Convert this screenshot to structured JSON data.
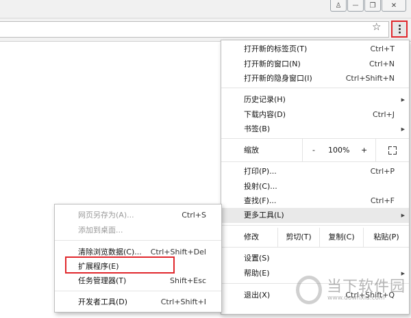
{
  "window_controls": {
    "user": "♙",
    "minimize": "—",
    "restore": "❐",
    "close": "✕"
  },
  "toolbar": {
    "star": "☆"
  },
  "main_menu": {
    "new_tab": {
      "label": "打开新的标签页(T)",
      "shortcut": "Ctrl+T"
    },
    "new_window": {
      "label": "打开新的窗口(N)",
      "shortcut": "Ctrl+N"
    },
    "new_incognito": {
      "label": "打开新的隐身窗口(I)",
      "shortcut": "Ctrl+Shift+N"
    },
    "history": {
      "label": "历史记录(H)"
    },
    "downloads": {
      "label": "下载内容(D)",
      "shortcut": "Ctrl+J"
    },
    "bookmarks": {
      "label": "书签(B)"
    },
    "zoom": {
      "label": "缩放",
      "minus": "-",
      "value": "100%",
      "plus": "+"
    },
    "print": {
      "label": "打印(P)...",
      "shortcut": "Ctrl+P"
    },
    "cast": {
      "label": "投射(C)..."
    },
    "find": {
      "label": "查找(F)...",
      "shortcut": "Ctrl+F"
    },
    "more_tools": {
      "label": "更多工具(L)"
    },
    "edit": {
      "label": "修改",
      "cut": "剪切(T)",
      "copy": "复制(C)",
      "paste": "粘贴(P)"
    },
    "settings": {
      "label": "设置(S)"
    },
    "help": {
      "label": "帮助(E)"
    },
    "exit": {
      "label": "退出(X)",
      "shortcut": "Ctrl+Shift+Q"
    }
  },
  "sub_menu": {
    "save_page": {
      "label": "网页另存为(A)...",
      "shortcut": "Ctrl+S"
    },
    "add_desktop": {
      "label": "添加到桌面..."
    },
    "clear_data": {
      "label": "清除浏览数据(C)...",
      "shortcut": "Ctrl+Shift+Del"
    },
    "extensions": {
      "label": "扩展程序(E)"
    },
    "task_manager": {
      "label": "任务管理器(T)",
      "shortcut": "Shift+Esc"
    },
    "dev_tools": {
      "label": "开发者工具(D)",
      "shortcut": "Ctrl+Shift+I"
    }
  },
  "watermark": {
    "text": "当下软件园",
    "url": "www.downxia.com"
  }
}
